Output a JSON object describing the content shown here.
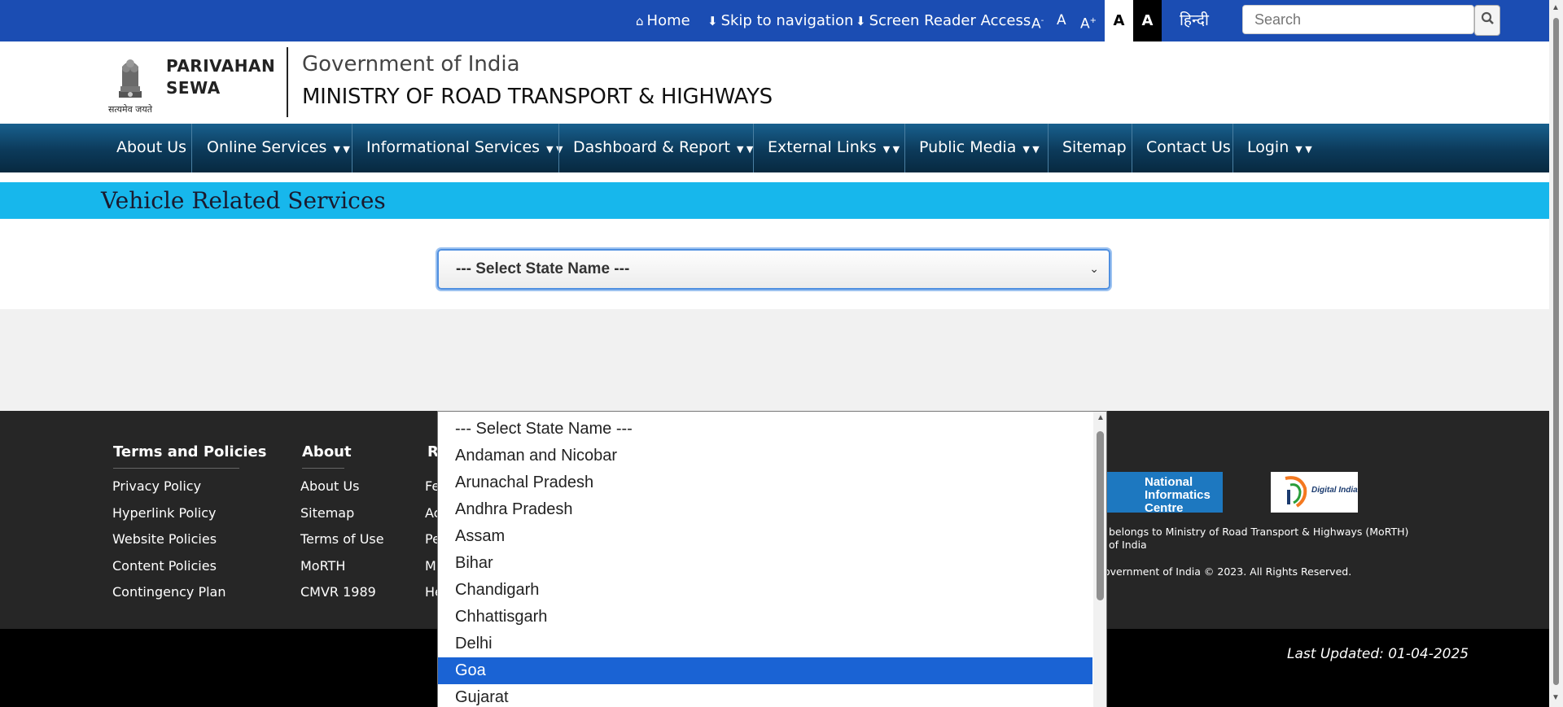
{
  "topbar": {
    "home": "Home",
    "skip": "Skip to navigation",
    "screen_reader": "Screen Reader Access",
    "font_decrease": "A",
    "font_decrease_sup": "-",
    "font_normal": "A",
    "font_increase": "A",
    "font_increase_sup": "+",
    "contrast_light": "A",
    "contrast_dark": "A",
    "hindi": "हिन्दी",
    "search_placeholder": "Search"
  },
  "header": {
    "emblem_motto": "सत्यमेव जयते",
    "brand_line1": "PARIVAHAN",
    "brand_line2": "SEWA",
    "gov": "Government of India",
    "ministry": "MINISTRY OF ROAD TRANSPORT & HIGHWAYS"
  },
  "nav": {
    "items": [
      {
        "label": "About Us",
        "has_dropdown": false
      },
      {
        "label": "Online Services",
        "has_dropdown": true
      },
      {
        "label": "Informational Services",
        "has_dropdown": true
      },
      {
        "label": "Dashboard & Report",
        "has_dropdown": true
      },
      {
        "label": "External Links",
        "has_dropdown": true
      },
      {
        "label": "Public Media",
        "has_dropdown": true
      },
      {
        "label": "Sitemap",
        "has_dropdown": false
      },
      {
        "label": "Contact Us",
        "has_dropdown": false
      },
      {
        "label": "Login",
        "has_dropdown": true
      }
    ]
  },
  "page": {
    "title": "Vehicle Related Services",
    "state_select_value": "--- Select State Name ---"
  },
  "dropdown": {
    "options": [
      "--- Select State Name ---",
      "Andaman and Nicobar",
      "Arunachal Pradesh",
      "Andhra Pradesh",
      "Assam",
      "Bihar",
      "Chandigarh",
      "Chhattisgarh",
      "Delhi",
      "Goa",
      "Gujarat"
    ],
    "highlighted": "Goa"
  },
  "footer": {
    "terms_heading": "Terms and Policies",
    "terms_links": [
      "Privacy Policy",
      "Hyperlink Policy",
      "Website Policies",
      "Content Policies",
      "Contingency Plan"
    ],
    "about_heading": "About",
    "about_links": [
      "About Us",
      "Sitemap",
      "Terms of Use",
      "MoRTH",
      "CMVR 1989"
    ],
    "third_heading_partial": "R",
    "third_links_partial": [
      "Fe",
      "Ac",
      "Pe",
      "M",
      "He"
    ],
    "nic_logo_text": "National Informatics Centre",
    "di_logo_text": "Digital India",
    "belongs_line1": "belongs to Ministry of Road Transport & Highways (MoRTH)",
    "belongs_line2": "of India",
    "copyright": "overnment of India © 2023. All Rights Reserved.",
    "last_updated": "Last Updated: 01-04-2025"
  },
  "colors": {
    "topbar": "#1b4db3",
    "band": "#17b7ec",
    "nav": "#0c3a5a",
    "highlight": "#1a63d4"
  }
}
